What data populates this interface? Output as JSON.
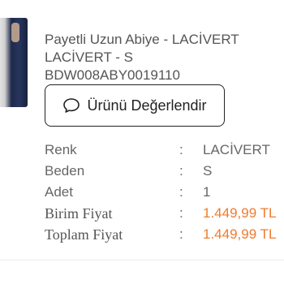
{
  "product": {
    "name": "Payetli Uzun Abiye - LACİVERT",
    "variant": "LACİVERT - S",
    "sku": "BDW008ABY0019110",
    "image_icon": "product-thumbnail"
  },
  "review_button": {
    "label": "Ürünü Değerlendir",
    "icon": "speech-bubble-icon"
  },
  "details": {
    "separator": ":",
    "rows": [
      {
        "label": "Renk",
        "value": "LACİVERT"
      },
      {
        "label": "Beden",
        "value": "S"
      },
      {
        "label": "Adet",
        "value": "1"
      },
      {
        "label": "Birim Fiyat",
        "value": "1.449,99 TL"
      },
      {
        "label": "Toplam Fiyat",
        "value": "1.449,99 TL"
      }
    ]
  },
  "colors": {
    "price": "#f07b2d",
    "text": "#666666",
    "button_border": "#222222"
  }
}
